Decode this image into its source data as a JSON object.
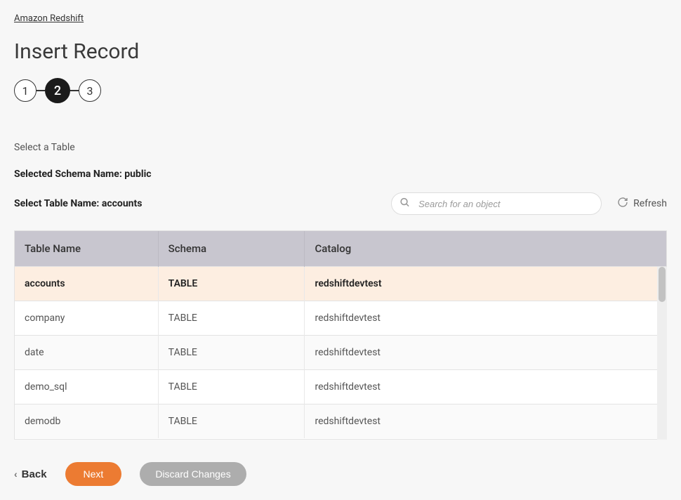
{
  "breadcrumb": "Amazon Redshift",
  "title": "Insert Record",
  "stepper": {
    "step1": "1",
    "step2": "2",
    "step3": "3"
  },
  "section_label": "Select a Table",
  "schema_line": "Selected Schema Name: public",
  "table_line": "Select Table Name: accounts",
  "search": {
    "placeholder": "Search for an object"
  },
  "refresh_label": "Refresh",
  "table": {
    "headers": {
      "name": "Table Name",
      "schema": "Schema",
      "catalog": "Catalog"
    },
    "rows": [
      {
        "name": "accounts",
        "schema": "TABLE",
        "catalog": "redshiftdevtest",
        "selected": true
      },
      {
        "name": "company",
        "schema": "TABLE",
        "catalog": "redshiftdevtest"
      },
      {
        "name": "date",
        "schema": "TABLE",
        "catalog": "redshiftdevtest"
      },
      {
        "name": "demo_sql",
        "schema": "TABLE",
        "catalog": "redshiftdevtest"
      },
      {
        "name": "demodb",
        "schema": "TABLE",
        "catalog": "redshiftdevtest"
      }
    ]
  },
  "footer": {
    "back": "Back",
    "next": "Next",
    "discard": "Discard Changes"
  }
}
